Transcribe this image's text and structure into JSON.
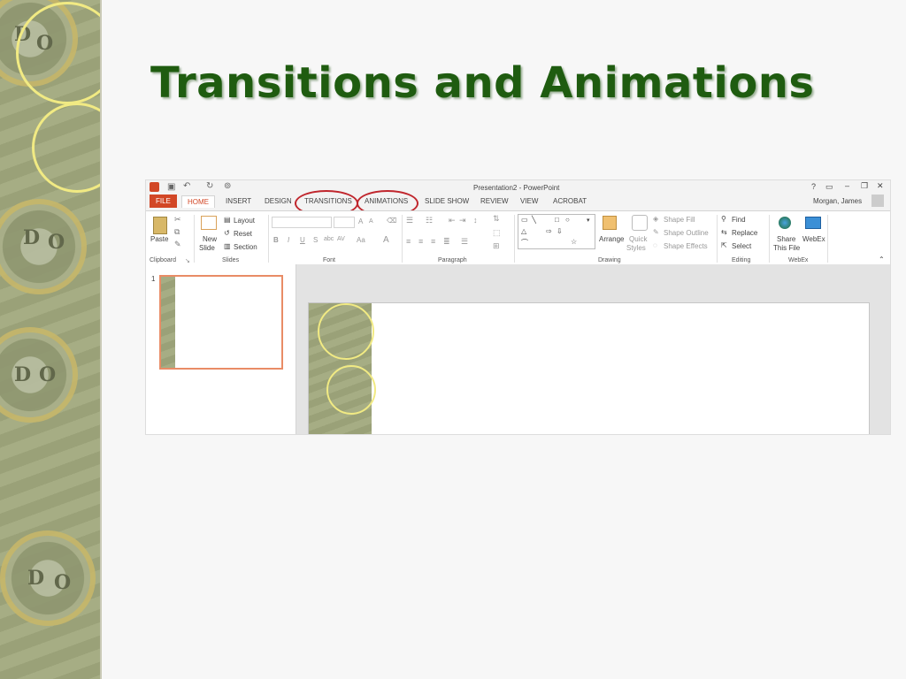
{
  "slide": {
    "title": "Transitions and Animations"
  },
  "window": {
    "title": "Presentation2 - PowerPoint",
    "user": "Morgan, James",
    "help": "?"
  },
  "tabs": [
    "FILE",
    "HOME",
    "INSERT",
    "DESIGN",
    "TRANSITIONS",
    "ANIMATIONS",
    "SLIDE SHOW",
    "REVIEW",
    "VIEW",
    "ACROBAT"
  ],
  "ribbon": {
    "clipboard": {
      "paste": "Paste",
      "label": "Clipboard"
    },
    "slides": {
      "new_slide_1": "New",
      "new_slide_2": "Slide",
      "layout": "Layout",
      "reset": "Reset",
      "section": "Section",
      "label": "Slides"
    },
    "font": {
      "bold": "B",
      "italic": "I",
      "underline": "U",
      "strike": "S",
      "grow": "A",
      "shrink": "A",
      "case": "Aa",
      "color": "A",
      "label": "Font"
    },
    "paragraph": {
      "label": "Paragraph"
    },
    "drawing": {
      "arrange": "Arrange",
      "quick_styles_1": "Quick",
      "quick_styles_2": "Styles",
      "shape_fill": "Shape Fill",
      "shape_outline": "Shape Outline",
      "shape_effects": "Shape Effects",
      "label": "Drawing"
    },
    "editing": {
      "find": "Find",
      "replace": "Replace",
      "select": "Select",
      "label": "Editing"
    },
    "webex": {
      "share_1": "Share",
      "share_2": "This File",
      "webex": "WebEx",
      "label": "WebEx"
    }
  },
  "thumbnails": {
    "number": "1"
  },
  "seal_letters": [
    "D",
    "O",
    "D",
    "O",
    "D",
    "O",
    "D",
    "O"
  ],
  "colors": {
    "title_green": "#1f5c10",
    "accent_orange": "#d24726",
    "highlight_red": "#c0262d"
  }
}
